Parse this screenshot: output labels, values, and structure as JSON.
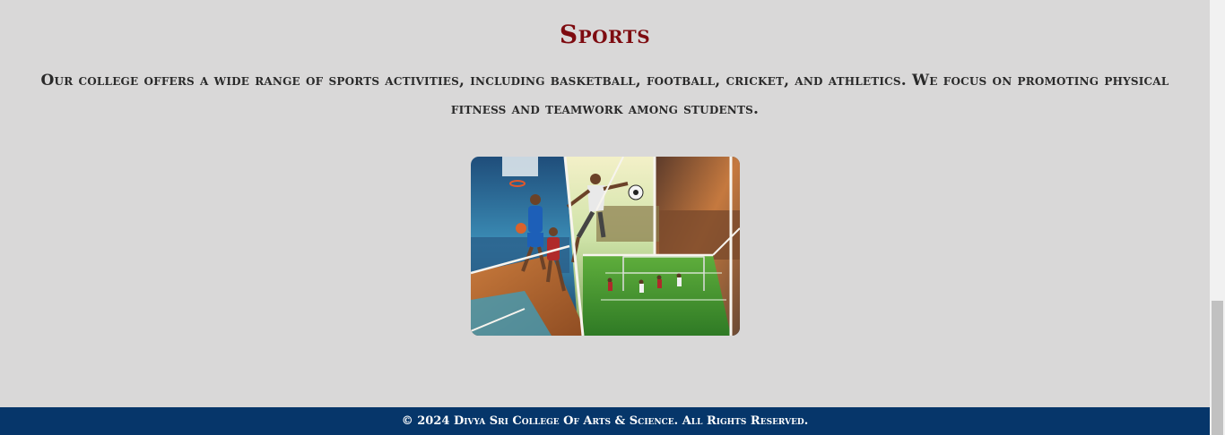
{
  "sports": {
    "title": "Sports",
    "description": "Our college offers a wide range of sports activities, including basketball, football, cricket, and athletics. We focus on promoting physical fitness and teamwork among students.",
    "image_icon": "sports-collage-image"
  },
  "footer": {
    "copyright": "© 2024 Divya Sri College Of Arts & Science. All Rights Reserved."
  },
  "colors": {
    "background": "#d9d8d8",
    "title": "#7e0b10",
    "text": "#2a2a2a",
    "footer_bg": "#06366a",
    "footer_text": "#ffffff"
  }
}
